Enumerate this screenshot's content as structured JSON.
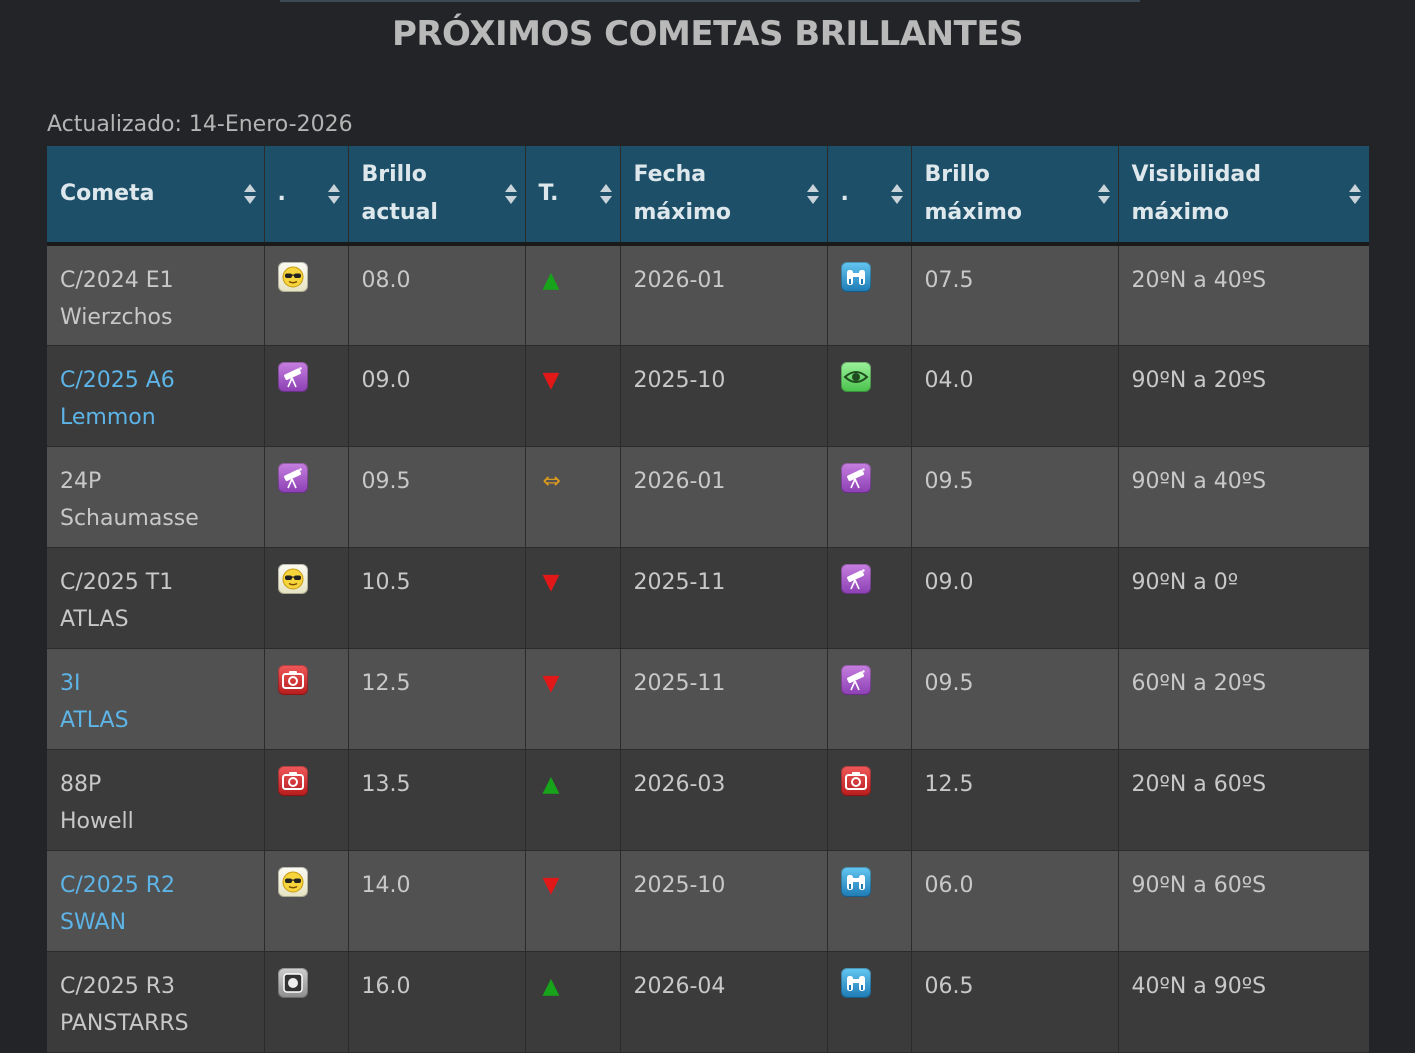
{
  "page": {
    "title": "PRÓXIMOS COMETAS BRILLANTES",
    "updated": "Actualizado: 14-Enero-2026"
  },
  "table": {
    "headers": [
      {
        "line1": "Cometa",
        "line2": ""
      },
      {
        "line1": ".",
        "line2": ""
      },
      {
        "line1": "Brillo",
        "line2": "actual"
      },
      {
        "line1": "T.",
        "line2": ""
      },
      {
        "line1": "Fecha",
        "line2": "máximo"
      },
      {
        "line1": ".",
        "line2": ""
      },
      {
        "line1": "Brillo",
        "line2": "máximo"
      },
      {
        "line1": "Visibilidad",
        "line2": "máximo"
      }
    ],
    "rows": [
      {
        "code": "C/2024 E1",
        "name": "Wierzchos",
        "linked": false,
        "icon": "sunglasses-icon",
        "brillo": "08.0",
        "trend": "▲",
        "trend_name": "trend-up-icon",
        "fecha": "2026-01",
        "icon_max": "binoculars-icon",
        "brillo_max": "07.5",
        "visibilidad": "20ºN a 40ºS"
      },
      {
        "code": "C/2025 A6",
        "name": "Lemmon",
        "linked": true,
        "icon": "telescope-icon",
        "brillo": "09.0",
        "trend": "▼",
        "trend_name": "trend-down-icon",
        "fecha": "2025-10",
        "icon_max": "naked-eye-icon",
        "brillo_max": "04.0",
        "visibilidad": "90ºN a 20ºS"
      },
      {
        "code": "24P",
        "name": "Schaumasse",
        "linked": false,
        "icon": "telescope-icon",
        "brillo": "09.5",
        "trend": "⇔",
        "trend_name": "trend-flat-icon",
        "fecha": "2026-01",
        "icon_max": "telescope-icon",
        "brillo_max": "09.5",
        "visibilidad": "90ºN a 40ºS"
      },
      {
        "code": "C/2025 T1",
        "name": "ATLAS",
        "linked": false,
        "icon": "sunglasses-icon",
        "brillo": "10.5",
        "trend": "▼",
        "trend_name": "trend-down-icon",
        "fecha": "2025-11",
        "icon_max": "telescope-icon",
        "brillo_max": "09.0",
        "visibilidad": "90ºN a 0º"
      },
      {
        "code": "3I",
        "name": "ATLAS",
        "linked": true,
        "icon": "camera-icon",
        "brillo": "12.5",
        "trend": "▼",
        "trend_name": "trend-down-icon",
        "fecha": "2025-11",
        "icon_max": "telescope-icon",
        "brillo_max": "09.5",
        "visibilidad": "60ºN a 20ºS"
      },
      {
        "code": "88P",
        "name": "Howell",
        "linked": false,
        "icon": "camera-icon",
        "brillo": "13.5",
        "trend": "▲",
        "trend_name": "trend-up-icon",
        "fecha": "2026-03",
        "icon_max": "camera-icon",
        "brillo_max": "12.5",
        "visibilidad": "20ºN a 60ºS"
      },
      {
        "code": "C/2025 R2",
        "name": "SWAN",
        "linked": true,
        "icon": "sunglasses-icon",
        "brillo": "14.0",
        "trend": "▼",
        "trend_name": "trend-down-icon",
        "fecha": "2025-10",
        "icon_max": "binoculars-icon",
        "brillo_max": "06.0",
        "visibilidad": "90ºN a 60ºS"
      },
      {
        "code": "C/2025 R3",
        "name": "PANSTARRS",
        "linked": false,
        "icon": "ccd-icon",
        "brillo": "16.0",
        "trend": "▲",
        "trend_name": "trend-up-icon",
        "fecha": "2026-04",
        "icon_max": "binoculars-icon",
        "brillo_max": "06.5",
        "visibilidad": "40ºN a 90ºS"
      }
    ]
  },
  "colors": {
    "background": "#232427",
    "header": "#1d5068",
    "row_light": "#515152",
    "row_dark": "#3b3b3c",
    "link": "#5db4e6",
    "trend_up": "#17a41b",
    "trend_down": "#e21818",
    "trend_flat": "#d99a1e"
  }
}
